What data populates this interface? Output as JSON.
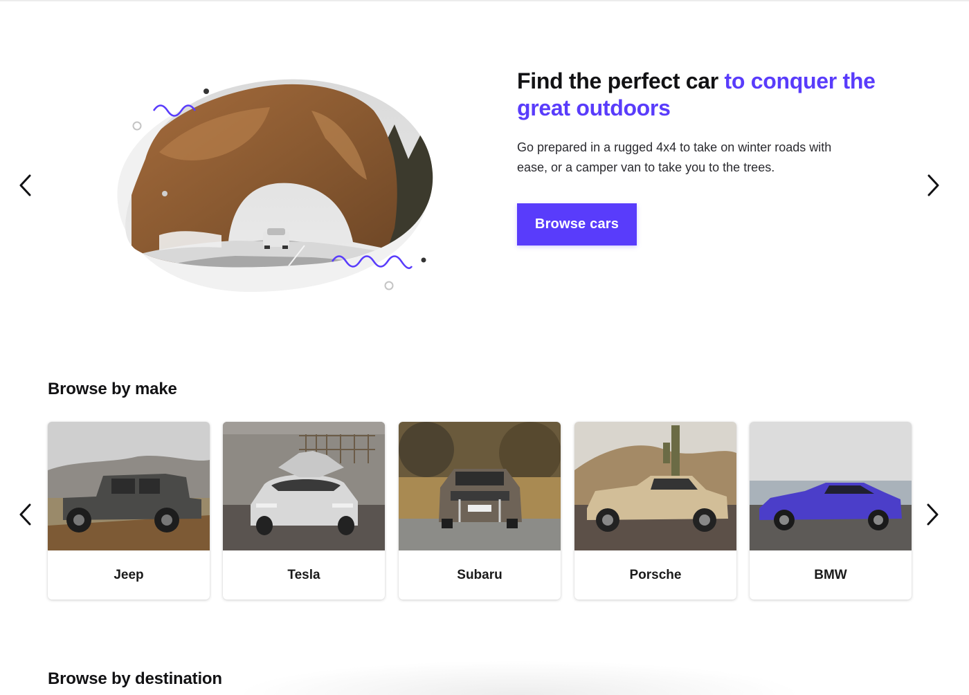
{
  "hero": {
    "title_part1": "Find the perfect car ",
    "title_accent": "to conquer the great outdoors",
    "subtitle": "Go prepared in a rugged 4x4 to take on winter roads with ease, or a camper van to take you to the trees.",
    "cta_label": "Browse cars",
    "accent_color": "#593cfb"
  },
  "carousel_controls": {
    "prev_icon": "chevron-left-icon",
    "next_icon": "chevron-right-icon"
  },
  "browse_by_make": {
    "title": "Browse by make",
    "makes": [
      {
        "label": "Jeep"
      },
      {
        "label": "Tesla"
      },
      {
        "label": "Subaru"
      },
      {
        "label": "Porsche"
      },
      {
        "label": "BMW"
      }
    ]
  },
  "browse_by_destination": {
    "title": "Browse by destination"
  }
}
